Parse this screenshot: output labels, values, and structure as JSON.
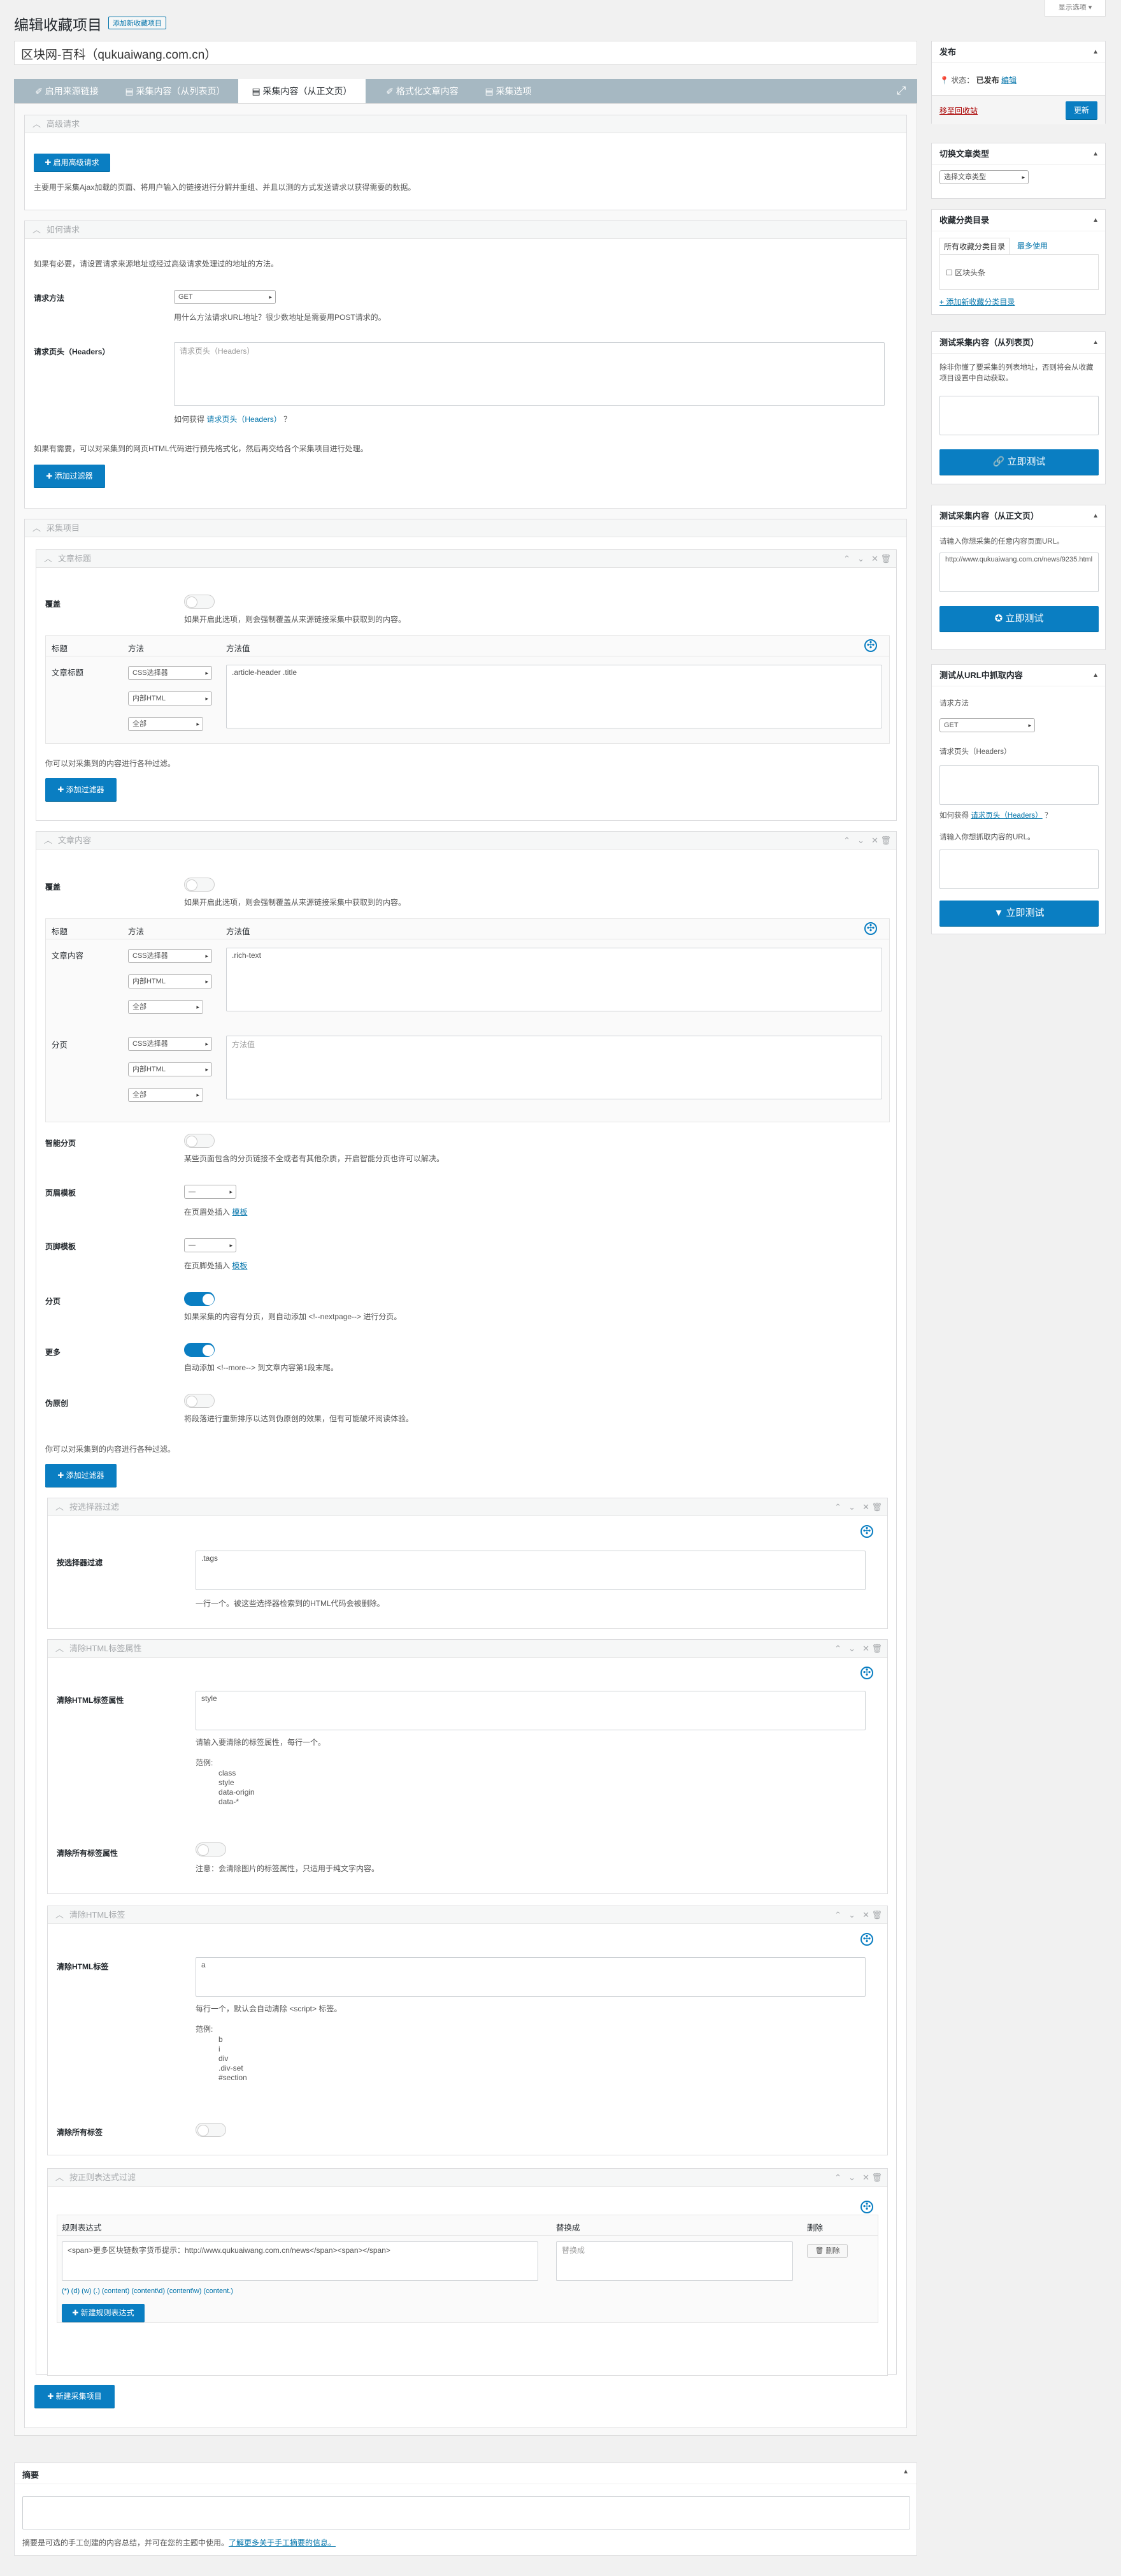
{
  "screen_options": "显示选项 ▾",
  "page_title": "编辑收藏项目",
  "add_new": "添加新收藏项目",
  "post_title": "区块网-百科（qukuaiwang.com.cn）",
  "tabs": [
    "✐ 启用来源链接",
    "▤ 采集内容（从列表页）",
    "▤ 采集内容（从正文页）",
    "✐ 格式化文章内容",
    "▤ 采集选项"
  ],
  "advanced": {
    "header": "高级请求",
    "button": "✚ 启用高级请求",
    "desc": "主要用于采集Ajax加载的页面、将用户输入的链接进行分解并重组、并且以测的方式发送请求以获得需要的数据。"
  },
  "request": {
    "header": "如何请求",
    "intro": "如果有必要，请设置请求来源地址或经过高级请求处理过的地址的方法。",
    "method_label": "请求方法",
    "method_value": "GET",
    "method_help": "用什么方法请求URL地址？很少数地址是需要用POST请求的。",
    "headers_label": "请求页头（Headers）",
    "headers_placeholder": "请求页头（Headers）",
    "headers_help_prefix": "如何获得",
    "headers_help_link": "请求页头（Headers）",
    "headers_help_suffix": "？",
    "html_filter_desc": "如果有需要，可以对采集到的网页HTML代码进行预先格式化，然后再交给各个采集项目进行处理。",
    "add_filter": "✚ 添加过滤器"
  },
  "items_header": "采集项目",
  "article_title": {
    "header": "文章标题",
    "cover_label": "覆盖",
    "cover_help": "如果开启此选项，则会强制覆盖从来源链接采集中获取到的内容。",
    "col_title": "标题",
    "col_method": "方法",
    "col_value": "方法值",
    "row_label": "文章标题",
    "selects": [
      "CSS选择器",
      "内部HTML",
      "全部"
    ],
    "value": ".article-header .title",
    "filter_note": "你可以对采集到的内容进行各种过滤。",
    "add_filter": "✚ 添加过滤器"
  },
  "article_content": {
    "header": "文章内容",
    "cover_label": "覆盖",
    "cover_help": "如果开启此选项，则会强制覆盖从来源链接采集中获取到的内容。",
    "col_title": "标题",
    "col_method": "方法",
    "col_value": "方法值",
    "row1_label": "文章内容",
    "row1_selects": [
      "CSS选择器",
      "内部HTML",
      "全部"
    ],
    "row1_value": ".rich-text",
    "row2_label": "分页",
    "row2_selects": [
      "CSS选择器",
      "内部HTML",
      "全部"
    ],
    "row2_placeholder": "方法值",
    "smart_label": "智能分页",
    "smart_help": "某些页面包含的分页链接不全或者有其他杂质，开启智能分页也许可以解决。",
    "header_tpl_label": "页眉模板",
    "header_tpl_value": "—",
    "header_tpl_help_prefix": "在页眉处插入",
    "header_tpl_help_link": "模板",
    "footer_tpl_label": "页脚模板",
    "footer_tpl_value": "—",
    "footer_tpl_help_prefix": "在页脚处插入",
    "footer_tpl_help_link": "模板",
    "paging_label": "分页",
    "paging_help": "如果采集的内容有分页，则自动添加 <!--nextpage--> 进行分页。",
    "more_label": "更多",
    "more_help": "自动添加 <!--more--> 到文章内容第1段末尾。",
    "pseudo_label": "伪原创",
    "pseudo_help": "将段落进行重新排序以达到伪原创的效果，但有可能破坏阅读体验。",
    "filter_note": "你可以对采集到的内容进行各种过滤。",
    "add_filter": "✚ 添加过滤器"
  },
  "filters": {
    "selector": {
      "header": "按选择器过滤",
      "label": "按选择器过滤",
      "value": ".tags",
      "help": "一行一个。被这些选择器检索到的HTML代码会被删除。"
    },
    "attr": {
      "header": "清除HTML标签属性",
      "label": "清除HTML标签属性",
      "value": "style",
      "help": "请输入要清除的标签属性，每行一个。",
      "example_title": "范例:",
      "examples": "class\nstyle\ndata-origin\ndata-*",
      "all_label": "清除所有标签属性",
      "all_help": "注意：会清除图片的标签属性，只适用于纯文字内容。"
    },
    "tags": {
      "header": "清除HTML标签",
      "label": "清除HTML标签",
      "value": "a",
      "help": "每行一个，默认会自动清除 <script> 标签。",
      "example_title": "范例:",
      "examples": "b\ni\ndiv\n.div-set\n#section",
      "all_label": "清除所有标签"
    },
    "regex": {
      "header": "按正则表达式过滤",
      "col_regex": "规则表达式",
      "col_replace": "替换成",
      "col_delete": "删除",
      "regex_value": "<span>更多区块链数字货币提示：http://www.qukuaiwang.com.cn/news</span><span></span>",
      "replace_placeholder": "替换成",
      "delete_button": "🗑 删除",
      "hint": "(*) (d) (w) (.) (content) (content\\d) (content\\w) (content.)",
      "add_button": "✚ 新建规则表达式"
    }
  },
  "add_item": "✚ 新建采集项目",
  "excerpt": {
    "header": "摘要",
    "help_prefix": "摘要是可选的手工创建的内容总结，并可在您的主题中使用。",
    "help_link": "了解更多关于手工摘要的信息。"
  },
  "sidebar": {
    "publish": {
      "title": "发布",
      "status_label": "状态：",
      "status_value": "已发布",
      "edit": "编辑",
      "trash": "移至回收站",
      "update": "更新"
    },
    "post_type": {
      "title": "切换文章类型",
      "value": "选择文章类型"
    },
    "category": {
      "title": "收藏分类目录",
      "tab_all": "所有收藏分类目录",
      "tab_popular": "最多使用",
      "item": "☐ 区块头条",
      "add_link": "+ 添加新收藏分类目录"
    },
    "test_list": {
      "title": "测试采集内容（从列表页）",
      "desc": "除非你懂了要采集的列表地址，否则将会从收藏项目设置中自动获取。",
      "button": "🔗 立即测试"
    },
    "test_body": {
      "title": "测试采集内容（从正文页）",
      "desc": "请输入你想采集的任意内容页面URL。",
      "url": "http://www.qukuaiwang.com.cn/news/9235.html",
      "button": "✪ 立即测试"
    },
    "test_url": {
      "title": "测试从URL中抓取内容",
      "method_label": "请求方法",
      "method_value": "GET",
      "headers_label": "请求页头（Headers）",
      "help_prefix": "如何获得",
      "help_link": "请求页头（Headers）",
      "help_suffix": "？",
      "url_label": "请输入你想抓取内容的URL。",
      "button": "▼ 立即测试"
    }
  },
  "colors": {
    "accent": "#0a7ec2",
    "tab_bg": "#a6b8c2",
    "active_tab_bg": "#ffffff",
    "danger": "#a00"
  }
}
